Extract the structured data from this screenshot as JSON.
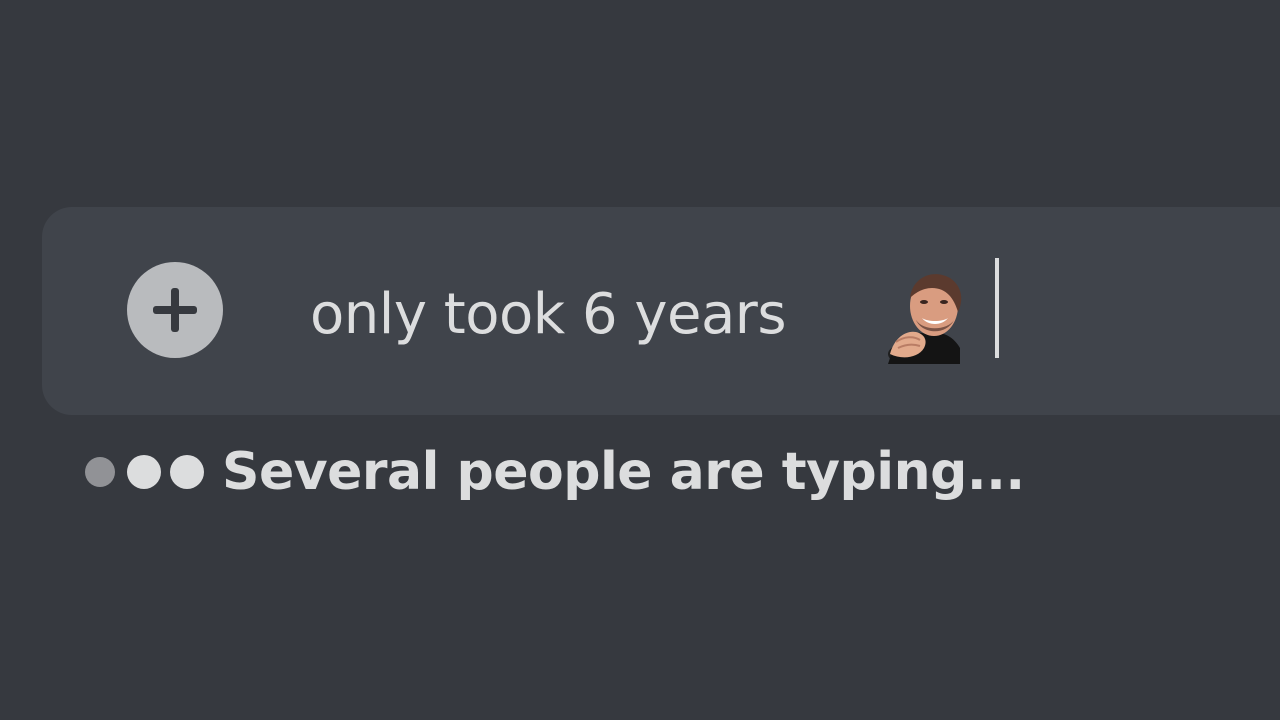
{
  "composer": {
    "message_text": "only took 6 years",
    "add_icon": "plus-circle-icon",
    "emoji_name": "laughing-man-emoji"
  },
  "typing_indicator": {
    "text": "Several people are typing...",
    "icon": "typing-dots-icon"
  },
  "colors": {
    "background": "#36393f",
    "composer_background": "#40444b",
    "text": "#dcddde",
    "icon_fill": "#b9bbbe"
  }
}
